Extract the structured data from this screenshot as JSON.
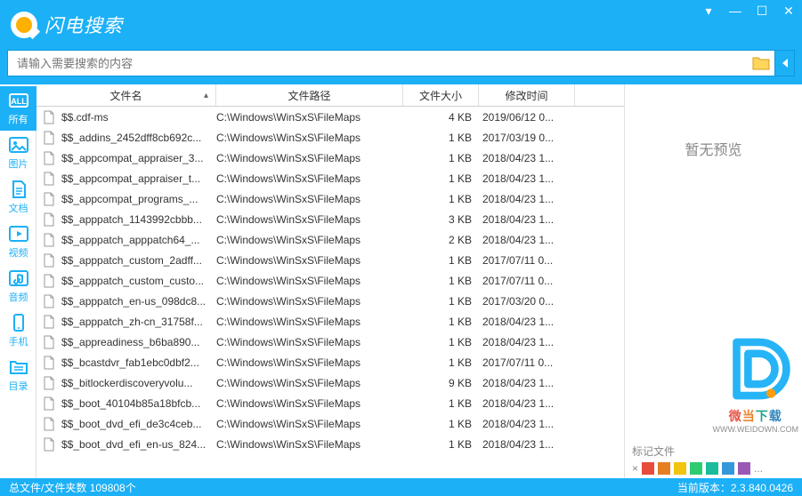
{
  "app": {
    "title": "闪电搜索"
  },
  "search": {
    "placeholder": "请输入需要搜索的内容",
    "value": ""
  },
  "sidebar": {
    "items": [
      {
        "label": "所有",
        "icon": "all"
      },
      {
        "label": "图片",
        "icon": "image"
      },
      {
        "label": "文档",
        "icon": "doc"
      },
      {
        "label": "视频",
        "icon": "video"
      },
      {
        "label": "音频",
        "icon": "audio"
      },
      {
        "label": "手机",
        "icon": "phone"
      },
      {
        "label": "目录",
        "icon": "folder-list"
      }
    ]
  },
  "columns": {
    "name": "文件名",
    "path": "文件路径",
    "size": "文件大小",
    "time": "修改时间"
  },
  "files": [
    {
      "name": "$$.cdf-ms",
      "path": "C:\\Windows\\WinSxS\\FileMaps",
      "size": "4 KB",
      "time": "2019/06/12 0..."
    },
    {
      "name": "$$_addins_2452dff8cb692c...",
      "path": "C:\\Windows\\WinSxS\\FileMaps",
      "size": "1 KB",
      "time": "2017/03/19 0..."
    },
    {
      "name": "$$_appcompat_appraiser_3...",
      "path": "C:\\Windows\\WinSxS\\FileMaps",
      "size": "1 KB",
      "time": "2018/04/23 1..."
    },
    {
      "name": "$$_appcompat_appraiser_t...",
      "path": "C:\\Windows\\WinSxS\\FileMaps",
      "size": "1 KB",
      "time": "2018/04/23 1..."
    },
    {
      "name": "$$_appcompat_programs_...",
      "path": "C:\\Windows\\WinSxS\\FileMaps",
      "size": "1 KB",
      "time": "2018/04/23 1..."
    },
    {
      "name": "$$_apppatch_1143992cbbb...",
      "path": "C:\\Windows\\WinSxS\\FileMaps",
      "size": "3 KB",
      "time": "2018/04/23 1..."
    },
    {
      "name": "$$_apppatch_apppatch64_...",
      "path": "C:\\Windows\\WinSxS\\FileMaps",
      "size": "2 KB",
      "time": "2018/04/23 1..."
    },
    {
      "name": "$$_apppatch_custom_2adff...",
      "path": "C:\\Windows\\WinSxS\\FileMaps",
      "size": "1 KB",
      "time": "2017/07/11 0..."
    },
    {
      "name": "$$_apppatch_custom_custo...",
      "path": "C:\\Windows\\WinSxS\\FileMaps",
      "size": "1 KB",
      "time": "2017/07/11 0..."
    },
    {
      "name": "$$_apppatch_en-us_098dc8...",
      "path": "C:\\Windows\\WinSxS\\FileMaps",
      "size": "1 KB",
      "time": "2017/03/20 0..."
    },
    {
      "name": "$$_apppatch_zh-cn_31758f...",
      "path": "C:\\Windows\\WinSxS\\FileMaps",
      "size": "1 KB",
      "time": "2018/04/23 1..."
    },
    {
      "name": "$$_appreadiness_b6ba890...",
      "path": "C:\\Windows\\WinSxS\\FileMaps",
      "size": "1 KB",
      "time": "2018/04/23 1..."
    },
    {
      "name": "$$_bcastdvr_fab1ebc0dbf2...",
      "path": "C:\\Windows\\WinSxS\\FileMaps",
      "size": "1 KB",
      "time": "2017/07/11 0..."
    },
    {
      "name": "$$_bitlockerdiscoveryvolu...",
      "path": "C:\\Windows\\WinSxS\\FileMaps",
      "size": "9 KB",
      "time": "2018/04/23 1..."
    },
    {
      "name": "$$_boot_40104b85a18bfcb...",
      "path": "C:\\Windows\\WinSxS\\FileMaps",
      "size": "1 KB",
      "time": "2018/04/23 1..."
    },
    {
      "name": "$$_boot_dvd_efi_de3c4ceb...",
      "path": "C:\\Windows\\WinSxS\\FileMaps",
      "size": "1 KB",
      "time": "2018/04/23 1..."
    },
    {
      "name": "$$_boot_dvd_efi_en-us_824...",
      "path": "C:\\Windows\\WinSxS\\FileMaps",
      "size": "1 KB",
      "time": "2018/04/23 1..."
    }
  ],
  "preview": {
    "empty_text": "暂无预览",
    "tag_label": "标记文件",
    "close": "×",
    "more": "..."
  },
  "status": {
    "left_label": "总文件/文件夹数",
    "count": "109808个",
    "right_label": "当前版本：",
    "version": "2.3.840.0426"
  },
  "watermark": {
    "brand": "微当下载",
    "url": "WWW.WEIDOWN.COM"
  },
  "tag_colors": [
    "#e74c3c",
    "#e67e22",
    "#f1c40f",
    "#2ecc71",
    "#1abc9c",
    "#3498db",
    "#9b59b6"
  ]
}
